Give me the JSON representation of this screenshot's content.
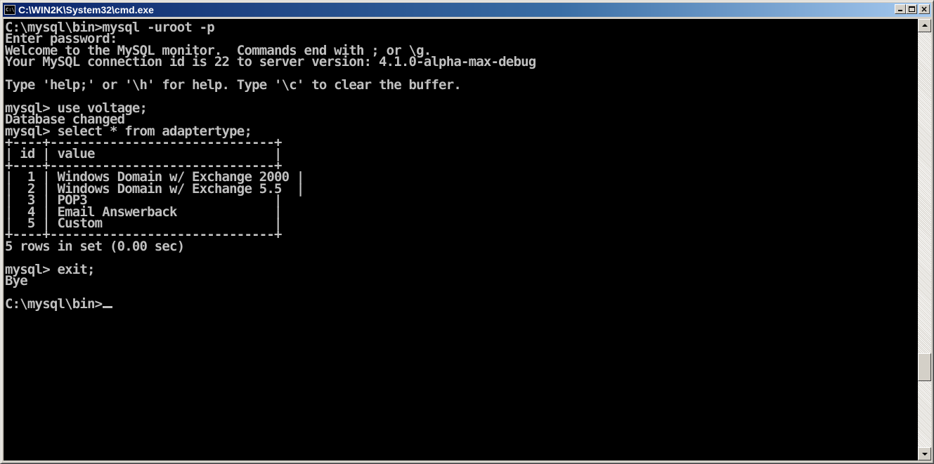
{
  "window": {
    "title": "C:\\WIN2K\\System32\\cmd.exe",
    "icon_label": "C:\\",
    "minimize_icon": "minimize-icon",
    "maximize_icon": "maximize-icon",
    "close_icon": "close-icon",
    "close_label": "×"
  },
  "console": {
    "text": "C:\\mysql\\bin>mysql -uroot -p\nEnter password:\nWelcome to the MySQL monitor.  Commands end with ; or \\g.\nYour MySQL connection id is 22 to server version: 4.1.0-alpha-max-debug\n\nType 'help;' or '\\h' for help. Type '\\c' to clear the buffer.\n\nmysql> use voltage;\nDatabase changed\nmysql> select * from adaptertype;\n+----+------------------------------+\n| id | value                        |\n+----+------------------------------+\n|  1 | Windows Domain w/ Exchange 2000 |\n|  2 | Windows Domain w/ Exchange 5.5  |\n|  3 | POP3                         |\n|  4 | Email Answerback             |\n|  5 | Custom                       |\n+----+------------------------------+\n5 rows in set (0.00 sec)\n\nmysql> exit;\nBye\n\nC:\\mysql\\bin>"
  },
  "colors": {
    "console_bg": "#000000",
    "console_fg": "#c0c0c0",
    "title_active": "#0a246a"
  }
}
